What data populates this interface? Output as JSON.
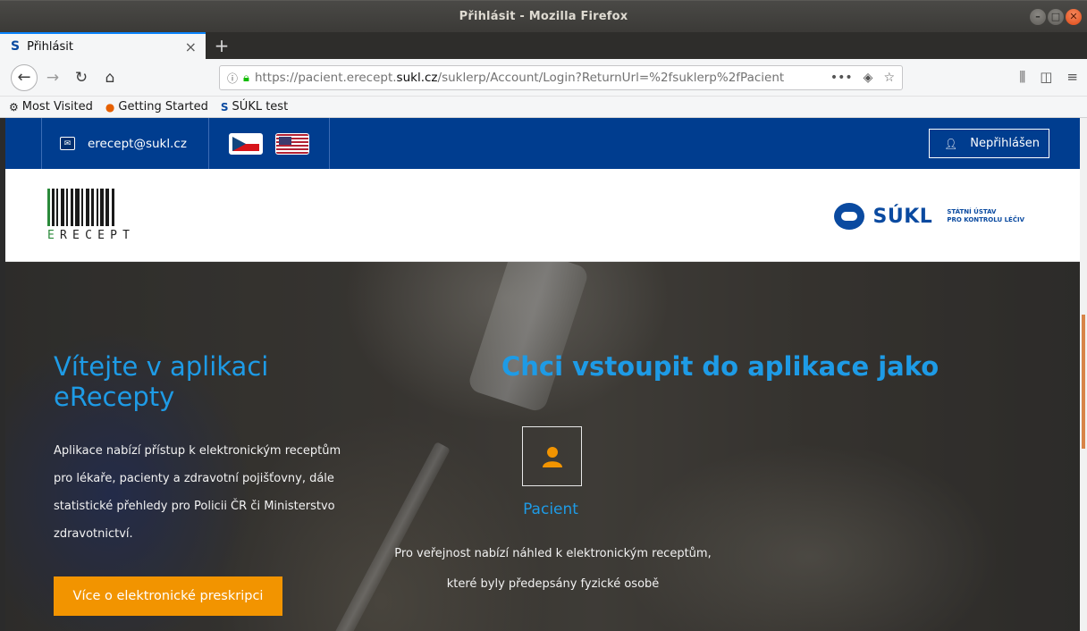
{
  "window": {
    "title": "Přihlásit - Mozilla Firefox"
  },
  "browser": {
    "tabs": [
      {
        "label": "Přihlásit",
        "active": true
      }
    ],
    "url": {
      "prefix": "https://pacient.erecept.",
      "domain": "sukl.cz",
      "path": "/suklerp/Account/Login?ReturnUrl=%2fsuklerp%2fPacient"
    },
    "bookmarks": [
      {
        "label": "Most Visited",
        "icon": "gear-icon"
      },
      {
        "label": "Getting Started",
        "icon": "firefox-icon"
      },
      {
        "label": "SÚKL test",
        "icon": "sukl-icon"
      }
    ]
  },
  "site": {
    "topbar": {
      "email": "erecept@sukl.cz",
      "login_status": "Nepřihlášen"
    },
    "logo": {
      "text": "ERECEPT"
    },
    "sukl": {
      "name": "SÚKL",
      "sub_line1": "STÁTNÍ ÚSTAV",
      "sub_line2": "PRO KONTROLU LÉČIV"
    },
    "hero": {
      "welcome_title": "Vítejte v aplikaci eRecepty",
      "welcome_text": "Aplikace nabízí přístup k elektronickým receptům pro lékaře, pacienty a zdravotní pojišťovny, dále statistické přehledy pro Policii ČR či Ministerstvo zdravotnictví.",
      "more_button": "Více o elektronické preskripci",
      "enter_title": "Chci vstoupit do aplikace jako",
      "patient_label": "Pacient",
      "patient_desc": "Pro veřejnost nabízí náhled k elektronickým receptům, které byly předepsány fyzické osobě"
    }
  },
  "colors": {
    "topbar": "#003d8f",
    "accent_blue": "#1e9be6",
    "orange": "#f29400",
    "firefox_accent": "#0a84ff"
  }
}
